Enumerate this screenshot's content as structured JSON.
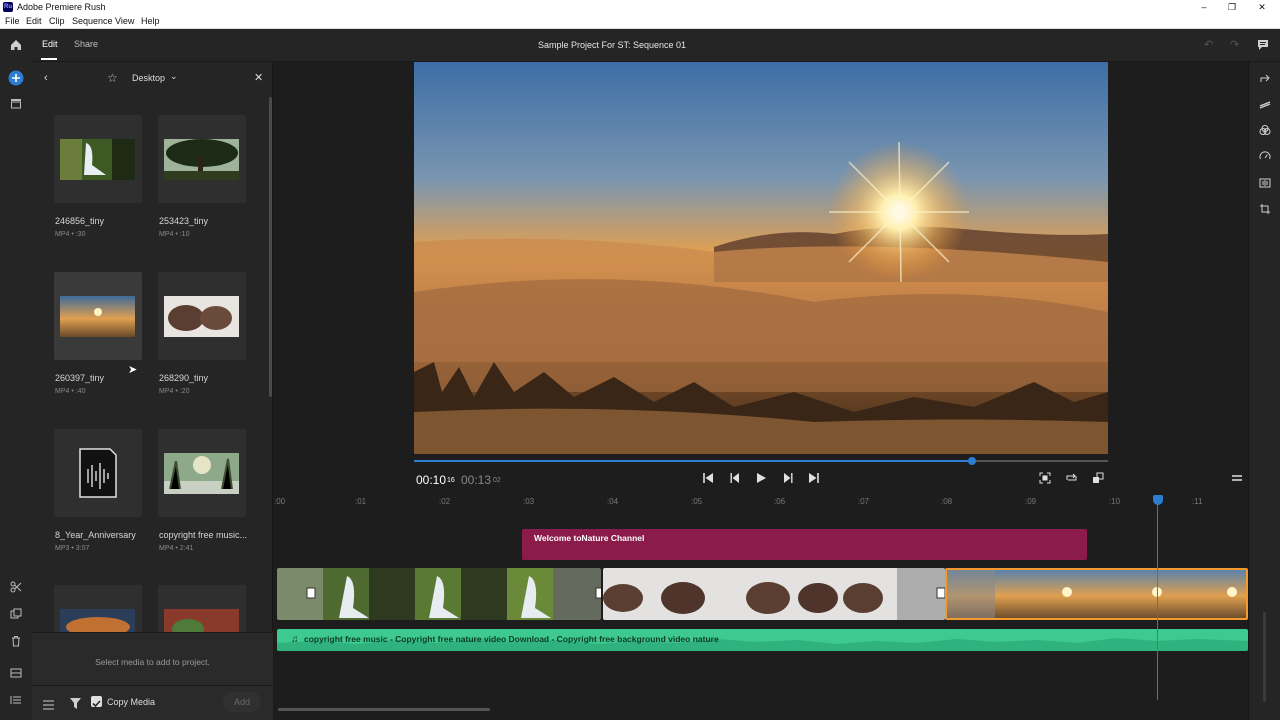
{
  "window": {
    "app_badge": "Ru",
    "title": "Adobe Premiere Rush",
    "controls": [
      "–",
      "❐",
      "✕"
    ]
  },
  "menu": [
    "File",
    "Edit",
    "Clip",
    "Sequence",
    "View",
    "Help"
  ],
  "topbar": {
    "tabs": [
      "Edit",
      "Share"
    ],
    "active_tab": "Edit",
    "project_title": "Sample Project For ST: Sequence 01"
  },
  "left_rail_icons": [
    "home-icon",
    "add-media-icon",
    "archive-icon",
    "scissors-icon",
    "duplicate-icon",
    "trash-icon",
    "layout-icon",
    "list-icon"
  ],
  "media_panel": {
    "location": "Desktop",
    "items": [
      {
        "name": "246856_tiny",
        "meta": "MP4 • :30",
        "thumb": "waterfall"
      },
      {
        "name": "253423_tiny",
        "meta": "MP4 • :10",
        "thumb": "tree"
      },
      {
        "name": "260397_tiny",
        "meta": "MP4 • :40",
        "thumb": "sunset"
      },
      {
        "name": "268290_tiny",
        "meta": "MP4 • :20",
        "thumb": "bison"
      },
      {
        "name": "8_Year_Anniversary",
        "meta": "MP3 • 3:07",
        "thumb": "audio"
      },
      {
        "name": "copyright free music...",
        "meta": "MP4 • 2:41",
        "thumb": "forest"
      },
      {
        "name": "",
        "meta": "",
        "thumb": "food"
      },
      {
        "name": "",
        "meta": "",
        "thumb": "food2"
      }
    ],
    "footer_hint": "Select media to add to project.",
    "copy_media_label": "Copy Media",
    "copy_media_checked": true,
    "add_label": "Add"
  },
  "player": {
    "current_time": "00:10",
    "current_frames": "16",
    "total_time": "00:13",
    "total_frames": "02",
    "progress": 0.804
  },
  "timeline": {
    "ruler_labels": [
      ":00",
      ":01",
      ":02",
      ":03",
      ":04",
      ":05",
      ":06",
      ":07",
      ":08",
      ":09",
      ":10",
      ":11"
    ],
    "title_clip": "Welcome toNature Channel",
    "audio_clip": "copyright free music - Copyright free nature video Download - Copyright free background video nature"
  },
  "right_rail_icons": [
    "export-icon",
    "transitions-icon",
    "color-icon",
    "speed-icon",
    "audio-icon",
    "transform-icon"
  ],
  "colors": {
    "accent": "#2d7dd2",
    "title_clip": "#8a1b4a",
    "audio_clip": "#3dc98f",
    "selected_clip": "#f29a2e"
  }
}
